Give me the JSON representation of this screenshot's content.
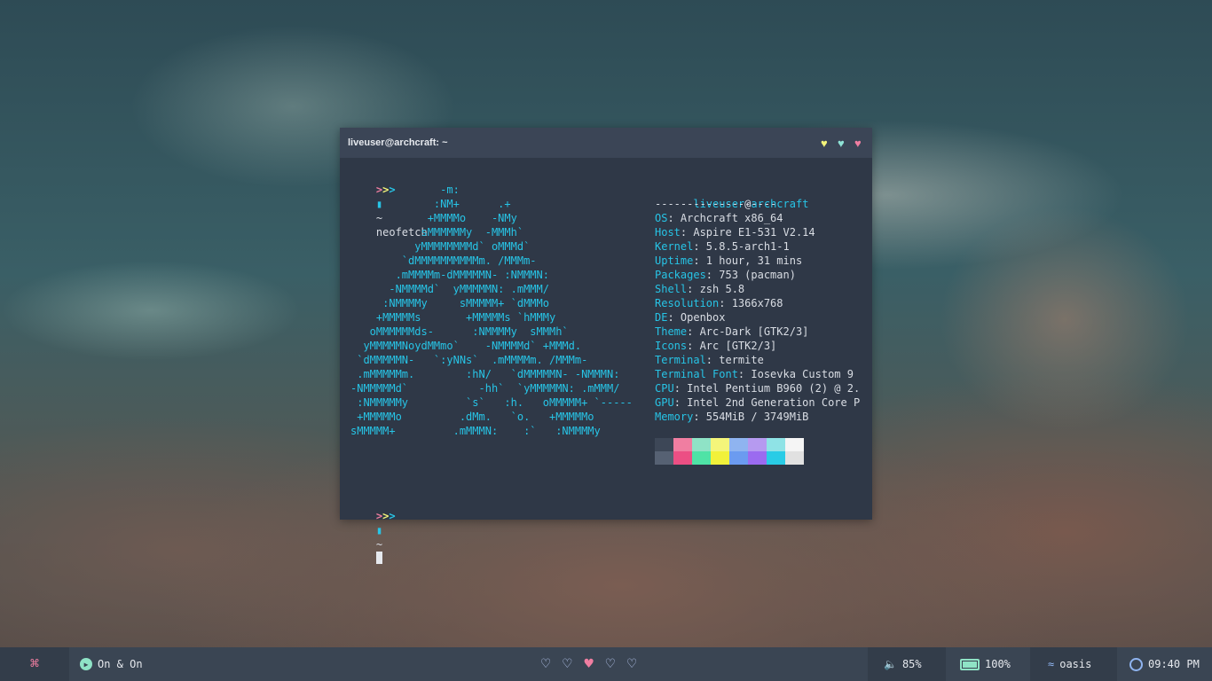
{
  "terminal": {
    "title": "liveuser@archcraft: ~",
    "window_buttons": [
      {
        "name": "minimize-button",
        "glyph": "♥",
        "color": "#f4f57a"
      },
      {
        "name": "maximize-button",
        "glyph": "♥",
        "color": "#8fe3d6"
      },
      {
        "name": "close-button",
        "glyph": "♥",
        "color": "#f07ea1"
      }
    ],
    "prompt_arrows": [
      ">",
      ">",
      ">"
    ],
    "prompt_arrow_colors": [
      "#f07ea1",
      "#f4f57a",
      "#27c4e6"
    ],
    "prompt_dir": "~",
    "command": "neofetch",
    "logo_lines": [
      "              -m:",
      "             :NM+      .+",
      "            +MMMMo    -NMy",
      "           sMMMMMMy  -MMMh`",
      "          yMMMMMMMMd` oMMMd`",
      "        `dMMMMMMMMMMm. /MMMm-",
      "       .mMMMMm-dMMMMMN- :NMMMN:",
      "      -NMMMMd`  yMMMMMN: .mMMM/",
      "     :NMMMMy     sMMMMM+ `dMMMo",
      "    +MMMMMs       +MMMMMs `hMMMy",
      "   oMMMMMMds-      :NMMMMy  sMMMh`",
      "  yMMMMMNoydMMmo`    -NMMMMd` +MMMd.",
      " `dMMMMMN-   `:yNNs`  .mMMMMm. /MMMm-",
      " .mMMMMMm.        :hN/   `dMMMMMN- -NMMMN:",
      "-NMMMMMd`           -hh`  `yMMMMMN: .mMMM/",
      " :NMMMMMy         `s`   :h.   oMMMMM+ `-----",
      " +MMMMMo         .dMm.   `o.   +MMMMMo",
      "sMMMMM+         .mMMMN:    :`   :NMMMMy"
    ],
    "info": {
      "user": "liveuser",
      "at": "@",
      "host": "archcraft",
      "separator": "-------------------",
      "rows": [
        {
          "key": "OS",
          "value": ": Archcraft x86_64"
        },
        {
          "key": "Host",
          "value": ": Aspire E1-531 V2.14"
        },
        {
          "key": "Kernel",
          "value": ": 5.8.5-arch1-1"
        },
        {
          "key": "Uptime",
          "value": ": 1 hour, 31 mins"
        },
        {
          "key": "Packages",
          "value": ": 753 (pacman)"
        },
        {
          "key": "Shell",
          "value": ": zsh 5.8"
        },
        {
          "key": "Resolution",
          "value": ": 1366x768"
        },
        {
          "key": "DE",
          "value": ": Openbox"
        },
        {
          "key": "Theme",
          "value": ": Arc-Dark [GTK2/3]"
        },
        {
          "key": "Icons",
          "value": ": Arc [GTK2/3]"
        },
        {
          "key": "Terminal",
          "value": ": termite"
        },
        {
          "key": "Terminal Font",
          "value": ": Iosevka Custom 9"
        },
        {
          "key": "CPU",
          "value": ": Intel Pentium B960 (2) @ 2."
        },
        {
          "key": "GPU",
          "value": ": Intel 2nd Generation Core P"
        },
        {
          "key": "Memory",
          "value": ": 554MiB / 3749MiB"
        }
      ],
      "palette_top": [
        "#3d4757",
        "#f07ea1",
        "#8fe3c6",
        "#f4f57a",
        "#8fb4f0",
        "#b69af0",
        "#8fe3e6",
        "#f5f5f5"
      ],
      "palette_bottom": [
        "#566173",
        "#ec4f84",
        "#4fe3a6",
        "#f1f13a",
        "#6b9bf0",
        "#9b6bf0",
        "#29cce6",
        "#e1e1e1"
      ]
    }
  },
  "taskbar": {
    "menu_icon": "command-icon",
    "menu_glyph": "⌘",
    "menu_color": "#f07ea1",
    "music_status": "On & On",
    "workspaces": [
      {
        "name": "workspace-1",
        "glyph": "♡",
        "active": false
      },
      {
        "name": "workspace-2",
        "glyph": "♡",
        "active": false
      },
      {
        "name": "workspace-3",
        "glyph": "♥",
        "active": true
      },
      {
        "name": "workspace-4",
        "glyph": "♡",
        "active": false
      },
      {
        "name": "workspace-5",
        "glyph": "♡",
        "active": false
      }
    ],
    "volume": "85%",
    "battery": "100%",
    "network": "oasis",
    "clock": "09:40 PM",
    "accent": "#8fb4f0",
    "active_heart_color": "#f07ea1",
    "icon_color": "#b8c8f2"
  }
}
